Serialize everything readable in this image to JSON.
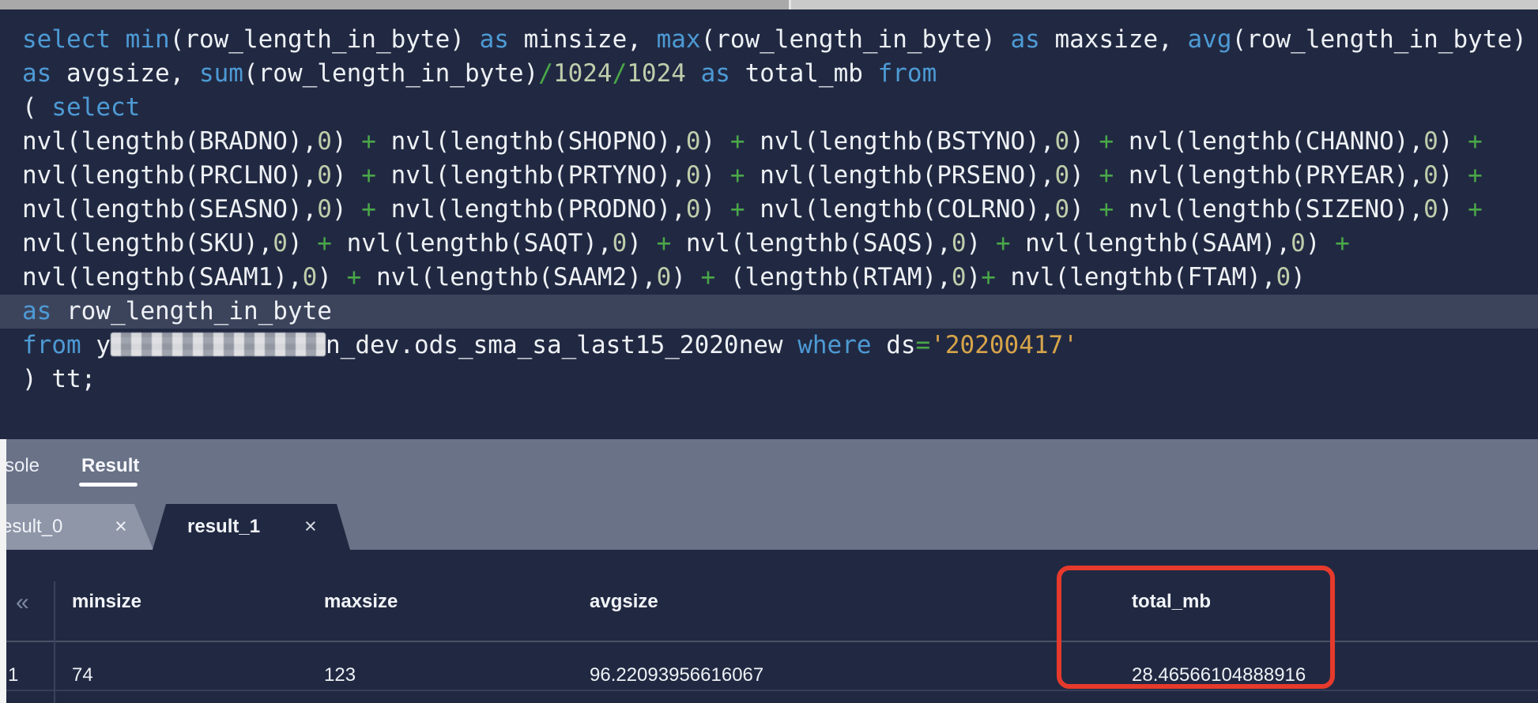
{
  "colors": {
    "editor_background": "#212942",
    "keyword_blue": "#4d9ad5",
    "plain_text": "#eef1f5",
    "number_green": "#bfcdab",
    "operator_green": "#4aa748",
    "string_gold": "#d7a44a",
    "selected_line": "#3c445c",
    "panel_gray": "#6a7288",
    "annotation_red": "#e63a2c"
  },
  "editor": {
    "highlighted_line_index": 8,
    "lines": [
      [
        [
          "k",
          "select "
        ],
        [
          "k",
          "min"
        ],
        [
          "w",
          "(row_length_in_byte) "
        ],
        [
          "k",
          "as "
        ],
        [
          "w",
          "minsize, "
        ],
        [
          "k",
          "max"
        ],
        [
          "w",
          "(row_length_in_byte) "
        ],
        [
          "k",
          "as "
        ],
        [
          "w",
          "maxsize, "
        ],
        [
          "k",
          "avg"
        ],
        [
          "w",
          "(row_length_in_byte)"
        ]
      ],
      [
        [
          "k",
          "as "
        ],
        [
          "w",
          "avgsize, "
        ],
        [
          "k",
          "sum"
        ],
        [
          "w",
          "(row_length_in_byte)"
        ],
        [
          "o",
          "/"
        ],
        [
          "n",
          "1024"
        ],
        [
          "o",
          "/"
        ],
        [
          "n",
          "1024"
        ],
        [
          "w",
          " "
        ],
        [
          "k",
          "as "
        ],
        [
          "w",
          "total_mb "
        ],
        [
          "k",
          "from"
        ]
      ],
      [
        [
          "w",
          "( "
        ],
        [
          "k",
          "select"
        ]
      ],
      [
        [
          "w",
          "nvl(lengthb(BRADNO),"
        ],
        [
          "n",
          "0"
        ],
        [
          "w",
          ") "
        ],
        [
          "o",
          "+"
        ],
        [
          "w",
          " nvl(lengthb(SHOPNO),"
        ],
        [
          "n",
          "0"
        ],
        [
          "w",
          ") "
        ],
        [
          "o",
          "+"
        ],
        [
          "w",
          " nvl(lengthb(BSTYNO),"
        ],
        [
          "n",
          "0"
        ],
        [
          "w",
          ") "
        ],
        [
          "o",
          "+"
        ],
        [
          "w",
          " nvl(lengthb(CHANNO),"
        ],
        [
          "n",
          "0"
        ],
        [
          "w",
          ") "
        ],
        [
          "o",
          "+"
        ]
      ],
      [
        [
          "w",
          "nvl(lengthb(PRCLNO),"
        ],
        [
          "n",
          "0"
        ],
        [
          "w",
          ") "
        ],
        [
          "o",
          "+"
        ],
        [
          "w",
          " nvl(lengthb(PRTYNO),"
        ],
        [
          "n",
          "0"
        ],
        [
          "w",
          ") "
        ],
        [
          "o",
          "+"
        ],
        [
          "w",
          " nvl(lengthb(PRSENO),"
        ],
        [
          "n",
          "0"
        ],
        [
          "w",
          ") "
        ],
        [
          "o",
          "+"
        ],
        [
          "w",
          " nvl(lengthb(PRYEAR),"
        ],
        [
          "n",
          "0"
        ],
        [
          "w",
          ") "
        ],
        [
          "o",
          "+"
        ]
      ],
      [
        [
          "w",
          "nvl(lengthb(SEASNO),"
        ],
        [
          "n",
          "0"
        ],
        [
          "w",
          ") "
        ],
        [
          "o",
          "+"
        ],
        [
          "w",
          " nvl(lengthb(PRODNO),"
        ],
        [
          "n",
          "0"
        ],
        [
          "w",
          ") "
        ],
        [
          "o",
          "+"
        ],
        [
          "w",
          " nvl(lengthb(COLRNO),"
        ],
        [
          "n",
          "0"
        ],
        [
          "w",
          ") "
        ],
        [
          "o",
          "+"
        ],
        [
          "w",
          " nvl(lengthb(SIZENO),"
        ],
        [
          "n",
          "0"
        ],
        [
          "w",
          ") "
        ],
        [
          "o",
          "+"
        ]
      ],
      [
        [
          "w",
          "nvl(lengthb(SKU),"
        ],
        [
          "n",
          "0"
        ],
        [
          "w",
          ") "
        ],
        [
          "o",
          "+"
        ],
        [
          "w",
          " nvl(lengthb(SAQT),"
        ],
        [
          "n",
          "0"
        ],
        [
          "w",
          ") "
        ],
        [
          "o",
          "+"
        ],
        [
          "w",
          " nvl(lengthb(SAQS),"
        ],
        [
          "n",
          "0"
        ],
        [
          "w",
          ") "
        ],
        [
          "o",
          "+"
        ],
        [
          "w",
          " nvl(lengthb(SAAM),"
        ],
        [
          "n",
          "0"
        ],
        [
          "w",
          ") "
        ],
        [
          "o",
          "+"
        ]
      ],
      [
        [
          "w",
          "nvl(lengthb(SAAM1),"
        ],
        [
          "n",
          "0"
        ],
        [
          "w",
          ") "
        ],
        [
          "o",
          "+"
        ],
        [
          "w",
          " nvl(lengthb(SAAM2),"
        ],
        [
          "n",
          "0"
        ],
        [
          "w",
          ") "
        ],
        [
          "o",
          "+"
        ],
        [
          "w",
          " (lengthb(RTAM),"
        ],
        [
          "n",
          "0"
        ],
        [
          "w",
          ")"
        ],
        [
          "o",
          "+"
        ],
        [
          "w",
          " nvl(lengthb(FTAM),"
        ],
        [
          "n",
          "0"
        ],
        [
          "w",
          ")"
        ]
      ],
      [
        [
          "k",
          "as "
        ],
        [
          "w",
          "row_length_in_byte"
        ]
      ],
      [
        [
          "k",
          "from "
        ],
        [
          "w",
          "y"
        ],
        [
          "blur",
          ""
        ],
        [
          "w",
          "n_dev.ods_sma_sa_last15_2020new "
        ],
        [
          "k",
          "where "
        ],
        [
          "w",
          "ds"
        ],
        [
          "o",
          "="
        ],
        [
          "s",
          "'20200417'"
        ]
      ],
      [
        [
          "w",
          ") tt;"
        ]
      ]
    ]
  },
  "results_panel": {
    "top_tabs": [
      {
        "label": "sole",
        "active": false
      },
      {
        "label": "Result",
        "active": true
      }
    ],
    "result_tabs": [
      {
        "label": "esult_0",
        "close_glyph": "×",
        "active": false
      },
      {
        "label": "result_1",
        "close_glyph": "×",
        "active": true
      }
    ]
  },
  "table": {
    "collapse_icon_glyph": "«",
    "columns": [
      "minsize",
      "maxsize",
      "avgsize",
      "total_mb"
    ],
    "rows": [
      {
        "index": "1",
        "values": [
          "74",
          "123",
          "96.22093956616067",
          "28.46566104888916"
        ]
      }
    ],
    "annotation": {
      "type": "red-box",
      "around_column": "total_mb"
    }
  }
}
